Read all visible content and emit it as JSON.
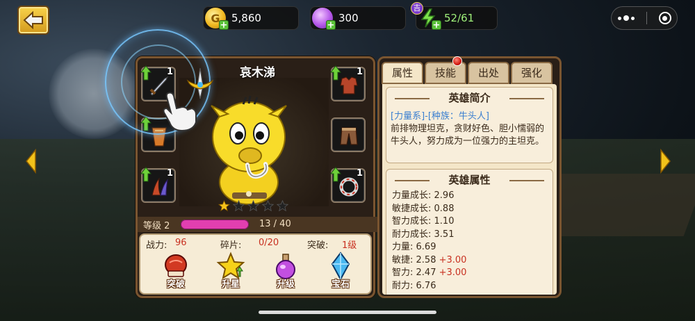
{
  "topbar": {
    "gold": "5,860",
    "gems": "300",
    "stamina": "52/61",
    "vip_badge": "吉"
  },
  "hero": {
    "name": "哀木涕",
    "stars_filled": 1,
    "stars_total": 5,
    "level_label": "等级 2",
    "xp": "13 / 40",
    "xp_fraction": 0.325,
    "equipment": [
      {
        "slot": "weapon",
        "icon": "sword-icon",
        "level": "1",
        "upgradable": true
      },
      {
        "slot": "armor",
        "icon": "chest-armor-icon",
        "level": "1",
        "upgradable": true
      },
      {
        "slot": "belt",
        "icon": "cape-icon",
        "level": "",
        "upgradable": true
      },
      {
        "slot": "pants",
        "icon": "pants-icon",
        "level": "",
        "upgradable": false
      },
      {
        "slot": "accessory",
        "icon": "claw-icon",
        "level": "1",
        "upgradable": true
      },
      {
        "slot": "ring",
        "icon": "ring-icon",
        "level": "1",
        "upgradable": true
      }
    ],
    "stats": {
      "power_label": "战力:",
      "power_value": "96",
      "shards_label": "碎片:",
      "shards_value": "0/20",
      "breakthrough_label": "突破:",
      "breakthrough_value": "1级"
    },
    "actions": [
      {
        "label": "突破",
        "icon": "boxing-glove-icon"
      },
      {
        "label": "升星",
        "icon": "star-upgrade-icon"
      },
      {
        "label": "升级",
        "icon": "potion-icon"
      },
      {
        "label": "宝石",
        "icon": "crystal-icon"
      }
    ]
  },
  "detail": {
    "tabs": [
      "属性",
      "技能",
      "出处",
      "强化"
    ],
    "active_tab": "属性",
    "intro_title": "英雄简介",
    "intro_tag": "[力量系]-[种族：牛头人]",
    "intro_text": "前排物理坦克，贪财好色、胆小懦弱的牛头人，努力成为一位强力的主坦克。",
    "attr_title": "英雄属性",
    "attributes": [
      {
        "label": "力量成长:",
        "value": "2.96",
        "bonus": ""
      },
      {
        "label": "敏捷成长:",
        "value": "0.88",
        "bonus": ""
      },
      {
        "label": "智力成长:",
        "value": "1.10",
        "bonus": ""
      },
      {
        "label": "耐力成长:",
        "value": "3.51",
        "bonus": ""
      },
      {
        "label": "力量:",
        "value": "6.69",
        "bonus": ""
      },
      {
        "label": "敏捷:",
        "value": "2.58",
        "bonus": "+3.00"
      },
      {
        "label": "智力:",
        "value": "2.47",
        "bonus": "+3.00"
      },
      {
        "label": "耐力:",
        "value": "6.76",
        "bonus": ""
      }
    ]
  },
  "colors": {
    "panel_border": "#7a5530",
    "xp_bar": "#e23fb0",
    "value_red": "#c83020",
    "tag_blue": "#3a7fd0"
  }
}
